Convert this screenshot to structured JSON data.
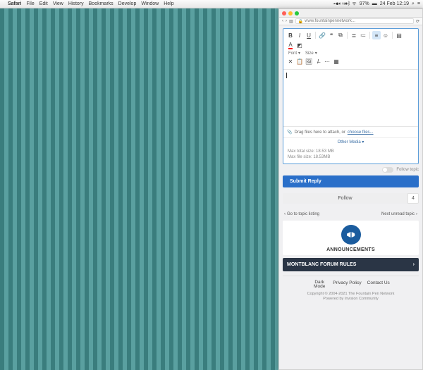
{
  "menubar": {
    "app": "Safari",
    "items": [
      "File",
      "Edit",
      "View",
      "History",
      "Bookmarks",
      "Develop",
      "Window",
      "Help"
    ],
    "battery": "97%",
    "datetime": "24 Feb 12:19"
  },
  "window": {
    "url": "www.fountainpennetwork..."
  },
  "toolbar": {
    "font_label": "Font",
    "size_label": "Size"
  },
  "attach": {
    "text": "Drag files here to attach, or ",
    "link": "choose files...",
    "other_media": "Other Media",
    "max_total": "Max total size: 18.53 MB",
    "max_file": "Max file size: 18.53MB"
  },
  "follow_topic": "Follow topic",
  "submit": "Submit Reply",
  "follow_bar": {
    "label": "Follow",
    "count": "4"
  },
  "nav": {
    "back": "Go to topic listing",
    "next": "Next unread topic"
  },
  "announcements": {
    "heading": "ANNOUNCEMENTS",
    "rule": "MONTBLANC FORUM RULES"
  },
  "footer": {
    "dark": "Dark Mode",
    "privacy": "Privacy Policy",
    "contact": "Contact Us",
    "copyright": "Copyright © 2004-2021 The Fountain Pen Network",
    "powered": "Powered by Invision Community"
  }
}
